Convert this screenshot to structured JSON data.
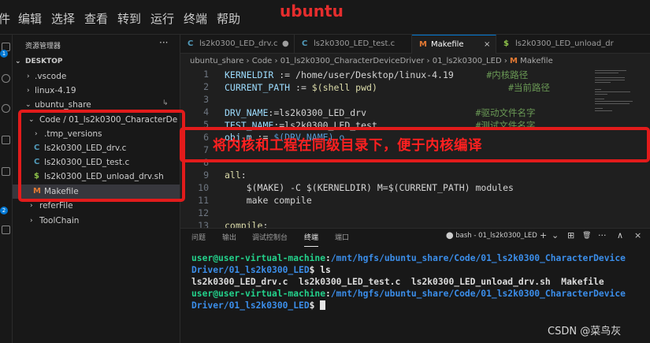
{
  "menubar": {
    "items": [
      "件",
      "编辑",
      "选择",
      "查看",
      "转到",
      "运行",
      "终端",
      "帮助"
    ]
  },
  "annotation_title": "ubuntu",
  "activity_badges": [
    "1",
    "2"
  ],
  "sidebar": {
    "title": "资源管理器",
    "more": "···",
    "section": "DESKTOP",
    "tree": [
      {
        "label": ".vscode",
        "chevron": "›",
        "icon": ""
      },
      {
        "label": "linux-4.19",
        "chevron": "›",
        "icon": ""
      },
      {
        "label": "ubuntu_share",
        "chevron": "⌄",
        "icon": ""
      },
      {
        "label": "Code / 01_ls2k0300_CharacterDe...",
        "chevron": "⌄",
        "icon": ""
      },
      {
        "label": ".tmp_versions",
        "chevron": "›",
        "icon": ""
      },
      {
        "label": "ls2k0300_LED_drv.c",
        "chevron": "",
        "icon": "C"
      },
      {
        "label": "ls2k0300_LED_test.c",
        "chevron": "",
        "icon": "C"
      },
      {
        "label": "ls2k0300_LED_unload_drv.sh",
        "chevron": "",
        "icon": "$"
      },
      {
        "label": "Makefile",
        "chevron": "",
        "icon": "M"
      },
      {
        "label": "referFile",
        "chevron": "›",
        "icon": ""
      },
      {
        "label": "ToolChain",
        "chevron": "›",
        "icon": ""
      }
    ]
  },
  "tabs": [
    {
      "label": "ls2k0300_LED_drv.c",
      "icon": "C",
      "tail": "●"
    },
    {
      "label": "ls2k0300_LED_test.c",
      "icon": "C",
      "tail": ""
    },
    {
      "label": "Makefile",
      "icon": "M",
      "tail": "×"
    },
    {
      "label": "ls2k0300_LED_unload_dr",
      "icon": "$",
      "tail": ""
    }
  ],
  "breadcrumb": [
    "ubuntu_share",
    "Code",
    "01_ls2k0300_CharacterDeviceDriver",
    "01_ls2k0300_LED",
    "Makefile"
  ],
  "code": {
    "line_numbers": [
      "1",
      "2",
      "3",
      "4",
      "5",
      "6",
      "7",
      "8",
      "9",
      "10",
      "11",
      "12",
      "13"
    ],
    "lines": [
      {
        "var": "KERNELDIR",
        "op": " := ",
        "val": "/home/user/Desktop/linux-4.19",
        "pad": "      ",
        "comment": "#内核路径"
      },
      {
        "var": "CURRENT_PATH",
        "op": " := ",
        "val": "$(shell pwd)",
        "pad": "                        ",
        "comment": "#当前路径"
      },
      {
        "var": "",
        "op": "",
        "val": "",
        "pad": "",
        "comment": ""
      },
      {
        "var": "DRV_NAME",
        "op": ":=",
        "val": "ls2k0300_LED_drv",
        "pad": "                    ",
        "comment": "#驱动文件名字"
      },
      {
        "var": "TEST_NAME",
        "op": ":=",
        "val": "ls2k0300_LED_test",
        "pad": "                  ",
        "comment": "#测试文件名字"
      },
      {
        "var": "obj-m",
        "op": " := ",
        "val": "$(DRV_NAME).o",
        "pad": "",
        "comment": ""
      },
      {
        "var": "",
        "op": "",
        "val": "",
        "pad": "",
        "comment": ""
      },
      {
        "var": "",
        "op": "",
        "val": "",
        "pad": "",
        "comment": ""
      },
      {
        "var": "all",
        "op": ":",
        "val": "",
        "pad": "",
        "comment": ""
      },
      {
        "var": "",
        "op": "",
        "val": "    $(MAKE) -C $(KERNELDIR) M=$(CURRENT_PATH) modules",
        "pad": "",
        "comment": ""
      },
      {
        "var": "",
        "op": "",
        "val": "    make compile",
        "pad": "",
        "comment": ""
      },
      {
        "var": "",
        "op": "",
        "val": "",
        "pad": "",
        "comment": ""
      },
      {
        "var": "compile",
        "op": ":",
        "val": "",
        "pad": "",
        "comment": ""
      }
    ]
  },
  "panel": {
    "tabs": [
      "问题",
      "输出",
      "调试控制台",
      "终端",
      "端口"
    ],
    "terminal_name": "bash - 01_ls2k0300_LED",
    "icons": [
      "+",
      "⌄",
      "⊞",
      "🗑",
      "···",
      "∧",
      "×"
    ]
  },
  "terminal": {
    "prompt_user": "user@user-virtual-machine",
    "prompt_path": "/mnt/hgfs/ubuntu_share/Code/01_ls2k0300_CharacterDevice",
    "prompt_path2": "Driver/01_ls2k0300_LED",
    "command": " ls",
    "output": "ls2k0300_LED_drv.c  ls2k0300_LED_test.c  ls2k0300_LED_unload_drv.sh  Makefile"
  },
  "annotation": "将内核和工程在同级目录下，便于内核编译",
  "watermark": "CSDN @菜鸟灰",
  "colors": {
    "annotation": "#ff2020",
    "accent": "#0078d4",
    "prompt_user": "#23d18b",
    "prompt_path": "#3b8eea"
  }
}
